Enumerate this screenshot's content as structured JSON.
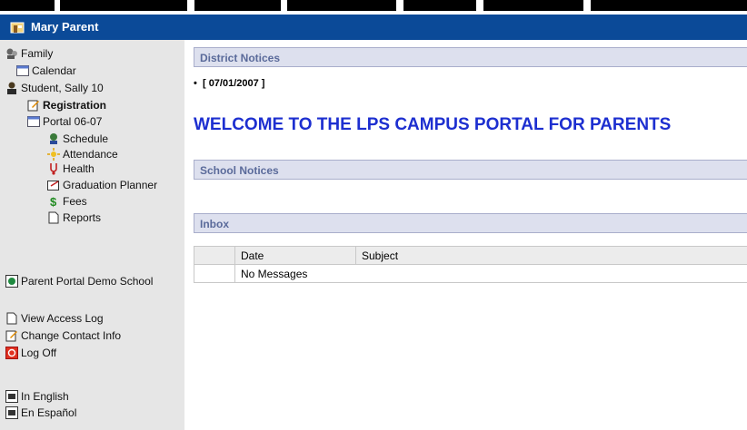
{
  "header": {
    "title": "Mary Parent"
  },
  "sidebar": {
    "family": "Family",
    "calendar": "Calendar",
    "student": "Student, Sally 10",
    "registration": "Registration",
    "portal": "Portal 06-07",
    "schedule": "Schedule",
    "attendance": "Attendance",
    "health": "Health",
    "graduation_planner": "Graduation Planner",
    "fees": "Fees",
    "reports": "Reports",
    "school": "Parent Portal Demo School",
    "view_access_log": "View Access Log",
    "change_contact_info": "Change Contact Info",
    "log_off": "Log Off",
    "in_english": "In English",
    "en_espanol": "En Español"
  },
  "main": {
    "district_notices_title": "District Notices",
    "notice_date": "[ 07/01/2007 ]",
    "welcome": "WELCOME TO THE LPS CAMPUS PORTAL FOR PARENTS",
    "school_notices_title": "School Notices",
    "inbox_title": "Inbox",
    "inbox_columns": [
      "Date",
      "Subject"
    ],
    "inbox_empty": "No Messages"
  },
  "colors": {
    "header_bg": "#0b4a98",
    "section_bar": "#dde0ee",
    "welcome_text": "#1d2fd0",
    "sidebar_bg": "#e6e6e6"
  }
}
